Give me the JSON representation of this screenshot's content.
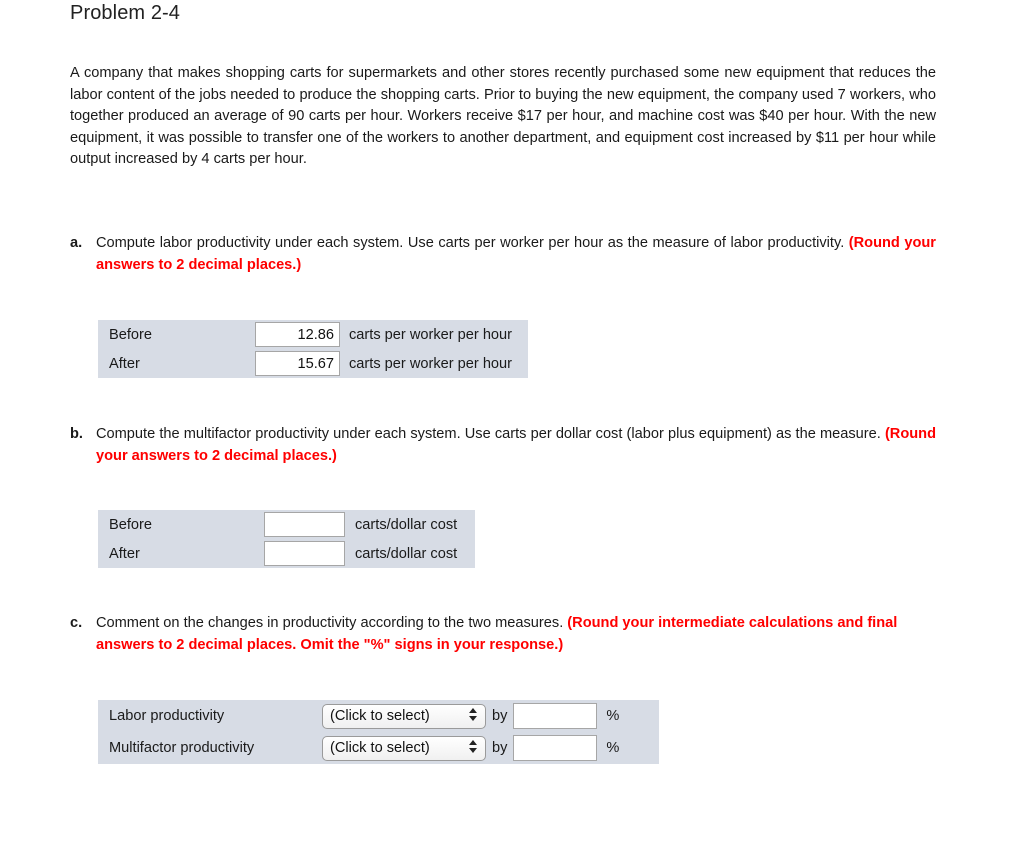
{
  "page": {
    "title": "Problem 2-4",
    "problem_text": "A company that makes shopping carts for supermarkets and other stores recently purchased some new equipment that reduces the labor content of the jobs needed to produce the shopping carts. Prior to buying the new equipment, the company used 7 workers, who together produced an average of 90 carts per hour. Workers receive $17 per hour, and machine cost was $40 per hour. With the new equipment, it was possible to transfer one of the workers to another department, and equipment cost increased by $11 per hour while output increased by 4 carts per hour."
  },
  "colors": {
    "hint_red": "#ff0000",
    "table_background": "#d7dce5",
    "input_border": "#a6a6a6",
    "text": "#1a1a1a"
  },
  "parts": {
    "a": {
      "marker": "a.",
      "text": "Compute labor productivity under each system. Use carts per worker per hour as the measure of labor productivity. ",
      "hint": "(Round your answers to 2 decimal places.)",
      "rows": [
        {
          "label": "Before",
          "value": "12.86",
          "unit": "carts per worker per hour"
        },
        {
          "label": "After",
          "value": "15.67",
          "unit": "carts per worker per hour"
        }
      ]
    },
    "b": {
      "marker": "b.",
      "text": "Compute the multifactor productivity under each system. Use carts per dollar cost (labor plus equipment) as the measure. ",
      "hint": "(Round your answers to 2 decimal places.)",
      "rows": [
        {
          "label": "Before",
          "value": "",
          "unit": "carts/dollar cost"
        },
        {
          "label": "After",
          "value": "",
          "unit": "carts/dollar cost"
        }
      ]
    },
    "c": {
      "marker": "c.",
      "text": "Comment on the changes in productivity according to the two measures. ",
      "hint": "(Round your intermediate calculations and final answers to 2 decimal places. Omit the  \"%\" signs in your response.)",
      "select_placeholder": "(Click to select)",
      "by_label": "by",
      "percent_label": "%",
      "rows": [
        {
          "label": "Labor productivity",
          "selected": "(Click to select)",
          "value": ""
        },
        {
          "label": "Multifactor productivity",
          "selected": "(Click to select)",
          "value": ""
        }
      ]
    }
  }
}
